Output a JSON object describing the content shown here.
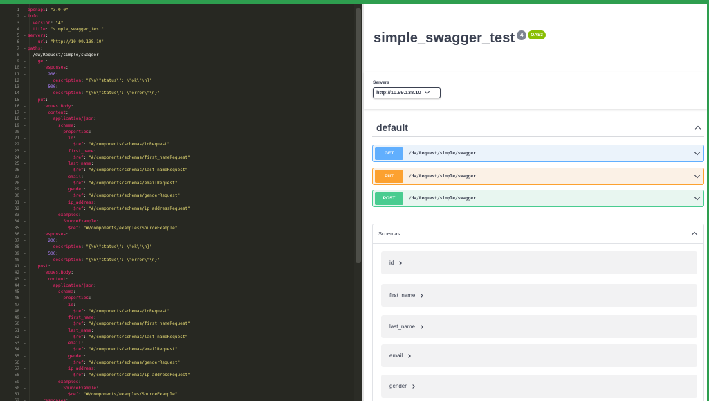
{
  "editor": {
    "lines": [
      [
        [
          "k",
          "openapi"
        ],
        [
          "c",
          ": "
        ],
        [
          "s",
          "\"3.0.0\""
        ]
      ],
      [
        [
          "k",
          "info"
        ],
        [
          "c",
          ":"
        ]
      ],
      [
        [
          "c",
          "  "
        ],
        [
          "k",
          "version"
        ],
        [
          "c",
          ": "
        ],
        [
          "s",
          "\"4\""
        ]
      ],
      [
        [
          "c",
          "  "
        ],
        [
          "k",
          "title"
        ],
        [
          "c",
          ": "
        ],
        [
          "s",
          "\"simple_swagger_test\""
        ]
      ],
      [
        [
          "k",
          "servers"
        ],
        [
          "c",
          ":"
        ]
      ],
      [
        [
          "c",
          "  - "
        ],
        [
          "k",
          "url"
        ],
        [
          "c",
          ": "
        ],
        [
          "s",
          "\"http://10.99.138.10\""
        ]
      ],
      [
        [
          "k",
          "paths"
        ],
        [
          "c",
          ":"
        ]
      ],
      [
        [
          "c",
          "  "
        ],
        [
          "c",
          "/dw/Request/simple/swagger:"
        ]
      ],
      [
        [
          "c",
          "    "
        ],
        [
          "k",
          "get"
        ],
        [
          "c",
          ":"
        ]
      ],
      [
        [
          "c",
          "      "
        ],
        [
          "k",
          "responses"
        ],
        [
          "c",
          ":"
        ]
      ],
      [
        [
          "c",
          "        "
        ],
        [
          "n",
          "200"
        ],
        [
          "c",
          ":"
        ]
      ],
      [
        [
          "c",
          "          "
        ],
        [
          "k",
          "description"
        ],
        [
          "c",
          ": "
        ],
        [
          "s",
          "\"{\\n\\\"status\\\": \\\"ok\\\"\\n}\""
        ]
      ],
      [
        [
          "c",
          "        "
        ],
        [
          "n",
          "500"
        ],
        [
          "c",
          ":"
        ]
      ],
      [
        [
          "c",
          "          "
        ],
        [
          "k",
          "description"
        ],
        [
          "c",
          ": "
        ],
        [
          "s",
          "\"{\\n\\\"status\\\": \\\"error\\\"\\n}\""
        ]
      ],
      [
        [
          "c",
          "    "
        ],
        [
          "k",
          "put"
        ],
        [
          "c",
          ":"
        ]
      ],
      [
        [
          "c",
          "      "
        ],
        [
          "k",
          "requestBody"
        ],
        [
          "c",
          ":"
        ]
      ],
      [
        [
          "c",
          "        "
        ],
        [
          "k",
          "content"
        ],
        [
          "c",
          ":"
        ]
      ],
      [
        [
          "c",
          "          "
        ],
        [
          "k",
          "application/json"
        ],
        [
          "c",
          ":"
        ]
      ],
      [
        [
          "c",
          "            "
        ],
        [
          "k",
          "schema"
        ],
        [
          "c",
          ":"
        ]
      ],
      [
        [
          "c",
          "              "
        ],
        [
          "k",
          "properties"
        ],
        [
          "c",
          ":"
        ]
      ],
      [
        [
          "c",
          "                "
        ],
        [
          "k",
          "id"
        ],
        [
          "c",
          ":"
        ]
      ],
      [
        [
          "c",
          "                  "
        ],
        [
          "k",
          "$ref"
        ],
        [
          "c",
          ": "
        ],
        [
          "s",
          "\"#/components/schemas/idRequest\""
        ]
      ],
      [
        [
          "c",
          "                "
        ],
        [
          "k",
          "first_name"
        ],
        [
          "c",
          ":"
        ]
      ],
      [
        [
          "c",
          "                  "
        ],
        [
          "k",
          "$ref"
        ],
        [
          "c",
          ": "
        ],
        [
          "s",
          "\"#/components/schemas/first_nameRequest\""
        ]
      ],
      [
        [
          "c",
          "                "
        ],
        [
          "k",
          "last_name"
        ],
        [
          "c",
          ":"
        ]
      ],
      [
        [
          "c",
          "                  "
        ],
        [
          "k",
          "$ref"
        ],
        [
          "c",
          ": "
        ],
        [
          "s",
          "\"#/components/schemas/last_nameRequest\""
        ]
      ],
      [
        [
          "c",
          "                "
        ],
        [
          "k",
          "email"
        ],
        [
          "c",
          ":"
        ]
      ],
      [
        [
          "c",
          "                  "
        ],
        [
          "k",
          "$ref"
        ],
        [
          "c",
          ": "
        ],
        [
          "s",
          "\"#/components/schemas/emailRequest\""
        ]
      ],
      [
        [
          "c",
          "                "
        ],
        [
          "k",
          "gender"
        ],
        [
          "c",
          ":"
        ]
      ],
      [
        [
          "c",
          "                  "
        ],
        [
          "k",
          "$ref"
        ],
        [
          "c",
          ": "
        ],
        [
          "s",
          "\"#/components/schemas/genderRequest\""
        ]
      ],
      [
        [
          "c",
          "                "
        ],
        [
          "k",
          "ip_address"
        ],
        [
          "c",
          ":"
        ]
      ],
      [
        [
          "c",
          "                  "
        ],
        [
          "k",
          "$ref"
        ],
        [
          "c",
          ": "
        ],
        [
          "s",
          "\"#/components/schemas/ip_addressRequest\""
        ]
      ],
      [
        [
          "c",
          "            "
        ],
        [
          "k",
          "examples"
        ],
        [
          "c",
          ":"
        ]
      ],
      [
        [
          "c",
          "              "
        ],
        [
          "k",
          "SourceExample"
        ],
        [
          "c",
          ":"
        ]
      ],
      [
        [
          "c",
          "                "
        ],
        [
          "k",
          "$ref"
        ],
        [
          "c",
          ": "
        ],
        [
          "s",
          "\"#/components/examples/SourceExample\""
        ]
      ],
      [
        [
          "c",
          "      "
        ],
        [
          "k",
          "responses"
        ],
        [
          "c",
          ":"
        ]
      ],
      [
        [
          "c",
          "        "
        ],
        [
          "n",
          "200"
        ],
        [
          "c",
          ":"
        ]
      ],
      [
        [
          "c",
          "          "
        ],
        [
          "k",
          "description"
        ],
        [
          "c",
          ": "
        ],
        [
          "s",
          "\"{\\n\\\"status\\\": \\\"ok\\\"\\n}\""
        ]
      ],
      [
        [
          "c",
          "        "
        ],
        [
          "n",
          "500"
        ],
        [
          "c",
          ":"
        ]
      ],
      [
        [
          "c",
          "          "
        ],
        [
          "k",
          "description"
        ],
        [
          "c",
          ": "
        ],
        [
          "s",
          "\"{\\n\\\"status\\\": \\\"error\\\"\\n}\""
        ]
      ],
      [
        [
          "c",
          "    "
        ],
        [
          "k",
          "post"
        ],
        [
          "c",
          ":"
        ]
      ],
      [
        [
          "c",
          "      "
        ],
        [
          "k",
          "requestBody"
        ],
        [
          "c",
          ":"
        ]
      ],
      [
        [
          "c",
          "        "
        ],
        [
          "k",
          "content"
        ],
        [
          "c",
          ":"
        ]
      ],
      [
        [
          "c",
          "          "
        ],
        [
          "k",
          "application/json"
        ],
        [
          "c",
          ":"
        ]
      ],
      [
        [
          "c",
          "            "
        ],
        [
          "k",
          "schema"
        ],
        [
          "c",
          ":"
        ]
      ],
      [
        [
          "c",
          "              "
        ],
        [
          "k",
          "properties"
        ],
        [
          "c",
          ":"
        ]
      ],
      [
        [
          "c",
          "                "
        ],
        [
          "k",
          "id"
        ],
        [
          "c",
          ":"
        ]
      ],
      [
        [
          "c",
          "                  "
        ],
        [
          "k",
          "$ref"
        ],
        [
          "c",
          ": "
        ],
        [
          "s",
          "\"#/components/schemas/idRequest\""
        ]
      ],
      [
        [
          "c",
          "                "
        ],
        [
          "k",
          "first_name"
        ],
        [
          "c",
          ":"
        ]
      ],
      [
        [
          "c",
          "                  "
        ],
        [
          "k",
          "$ref"
        ],
        [
          "c",
          ": "
        ],
        [
          "s",
          "\"#/components/schemas/first_nameRequest\""
        ]
      ],
      [
        [
          "c",
          "                "
        ],
        [
          "k",
          "last_name"
        ],
        [
          "c",
          ":"
        ]
      ],
      [
        [
          "c",
          "                  "
        ],
        [
          "k",
          "$ref"
        ],
        [
          "c",
          ": "
        ],
        [
          "s",
          "\"#/components/schemas/last_nameRequest\""
        ]
      ],
      [
        [
          "c",
          "                "
        ],
        [
          "k",
          "email"
        ],
        [
          "c",
          ":"
        ]
      ],
      [
        [
          "c",
          "                  "
        ],
        [
          "k",
          "$ref"
        ],
        [
          "c",
          ": "
        ],
        [
          "s",
          "\"#/components/schemas/emailRequest\""
        ]
      ],
      [
        [
          "c",
          "                "
        ],
        [
          "k",
          "gender"
        ],
        [
          "c",
          ":"
        ]
      ],
      [
        [
          "c",
          "                  "
        ],
        [
          "k",
          "$ref"
        ],
        [
          "c",
          ": "
        ],
        [
          "s",
          "\"#/components/schemas/genderRequest\""
        ]
      ],
      [
        [
          "c",
          "                "
        ],
        [
          "k",
          "ip_address"
        ],
        [
          "c",
          ":"
        ]
      ],
      [
        [
          "c",
          "                  "
        ],
        [
          "k",
          "$ref"
        ],
        [
          "c",
          ": "
        ],
        [
          "s",
          "\"#/components/schemas/ip_addressRequest\""
        ]
      ],
      [
        [
          "c",
          "            "
        ],
        [
          "k",
          "examples"
        ],
        [
          "c",
          ":"
        ]
      ],
      [
        [
          "c",
          "              "
        ],
        [
          "k",
          "SourceExample"
        ],
        [
          "c",
          ":"
        ]
      ],
      [
        [
          "c",
          "                "
        ],
        [
          "k",
          "$ref"
        ],
        [
          "c",
          ": "
        ],
        [
          "s",
          "\"#/components/examples/SourceExample\""
        ]
      ],
      [
        [
          "c",
          "      "
        ],
        [
          "k",
          "responses"
        ],
        [
          "c",
          ":"
        ]
      ],
      [
        [
          "c",
          "        "
        ],
        [
          "n",
          "200"
        ],
        [
          "c",
          ":"
        ]
      ]
    ],
    "foldable_lines": [
      2,
      5,
      7,
      8,
      9,
      10,
      11,
      13,
      15,
      16,
      17,
      18,
      19,
      20,
      21,
      23,
      25,
      27,
      29,
      31,
      33,
      34,
      36,
      37,
      39,
      41,
      42,
      43,
      44,
      45,
      46,
      47,
      49,
      51,
      53,
      55,
      57,
      59,
      60,
      62,
      63
    ],
    "syntax_colors": {
      "key": "#f92672",
      "string": "#e6db74",
      "number": "#ae81ff",
      "text": "#f8f8f2",
      "background": "#272822"
    }
  },
  "swagger": {
    "title": "simple_swagger_test",
    "version_badge": "4",
    "oas_badge": "OAS3",
    "servers_label": "Servers",
    "server_selected": "http://10.99.138.10",
    "tag": "default",
    "operations": [
      {
        "method": "GET",
        "path": "/dw/Request/simple/swagger",
        "color": "#61affe"
      },
      {
        "method": "PUT",
        "path": "/dw/Request/simple/swagger",
        "color": "#fca130"
      },
      {
        "method": "POST",
        "path": "/dw/Request/simple/swagger",
        "color": "#49cc90"
      }
    ],
    "schemas_title": "Schemas",
    "schemas": [
      "id",
      "first_name",
      "last_name",
      "email",
      "gender"
    ]
  }
}
